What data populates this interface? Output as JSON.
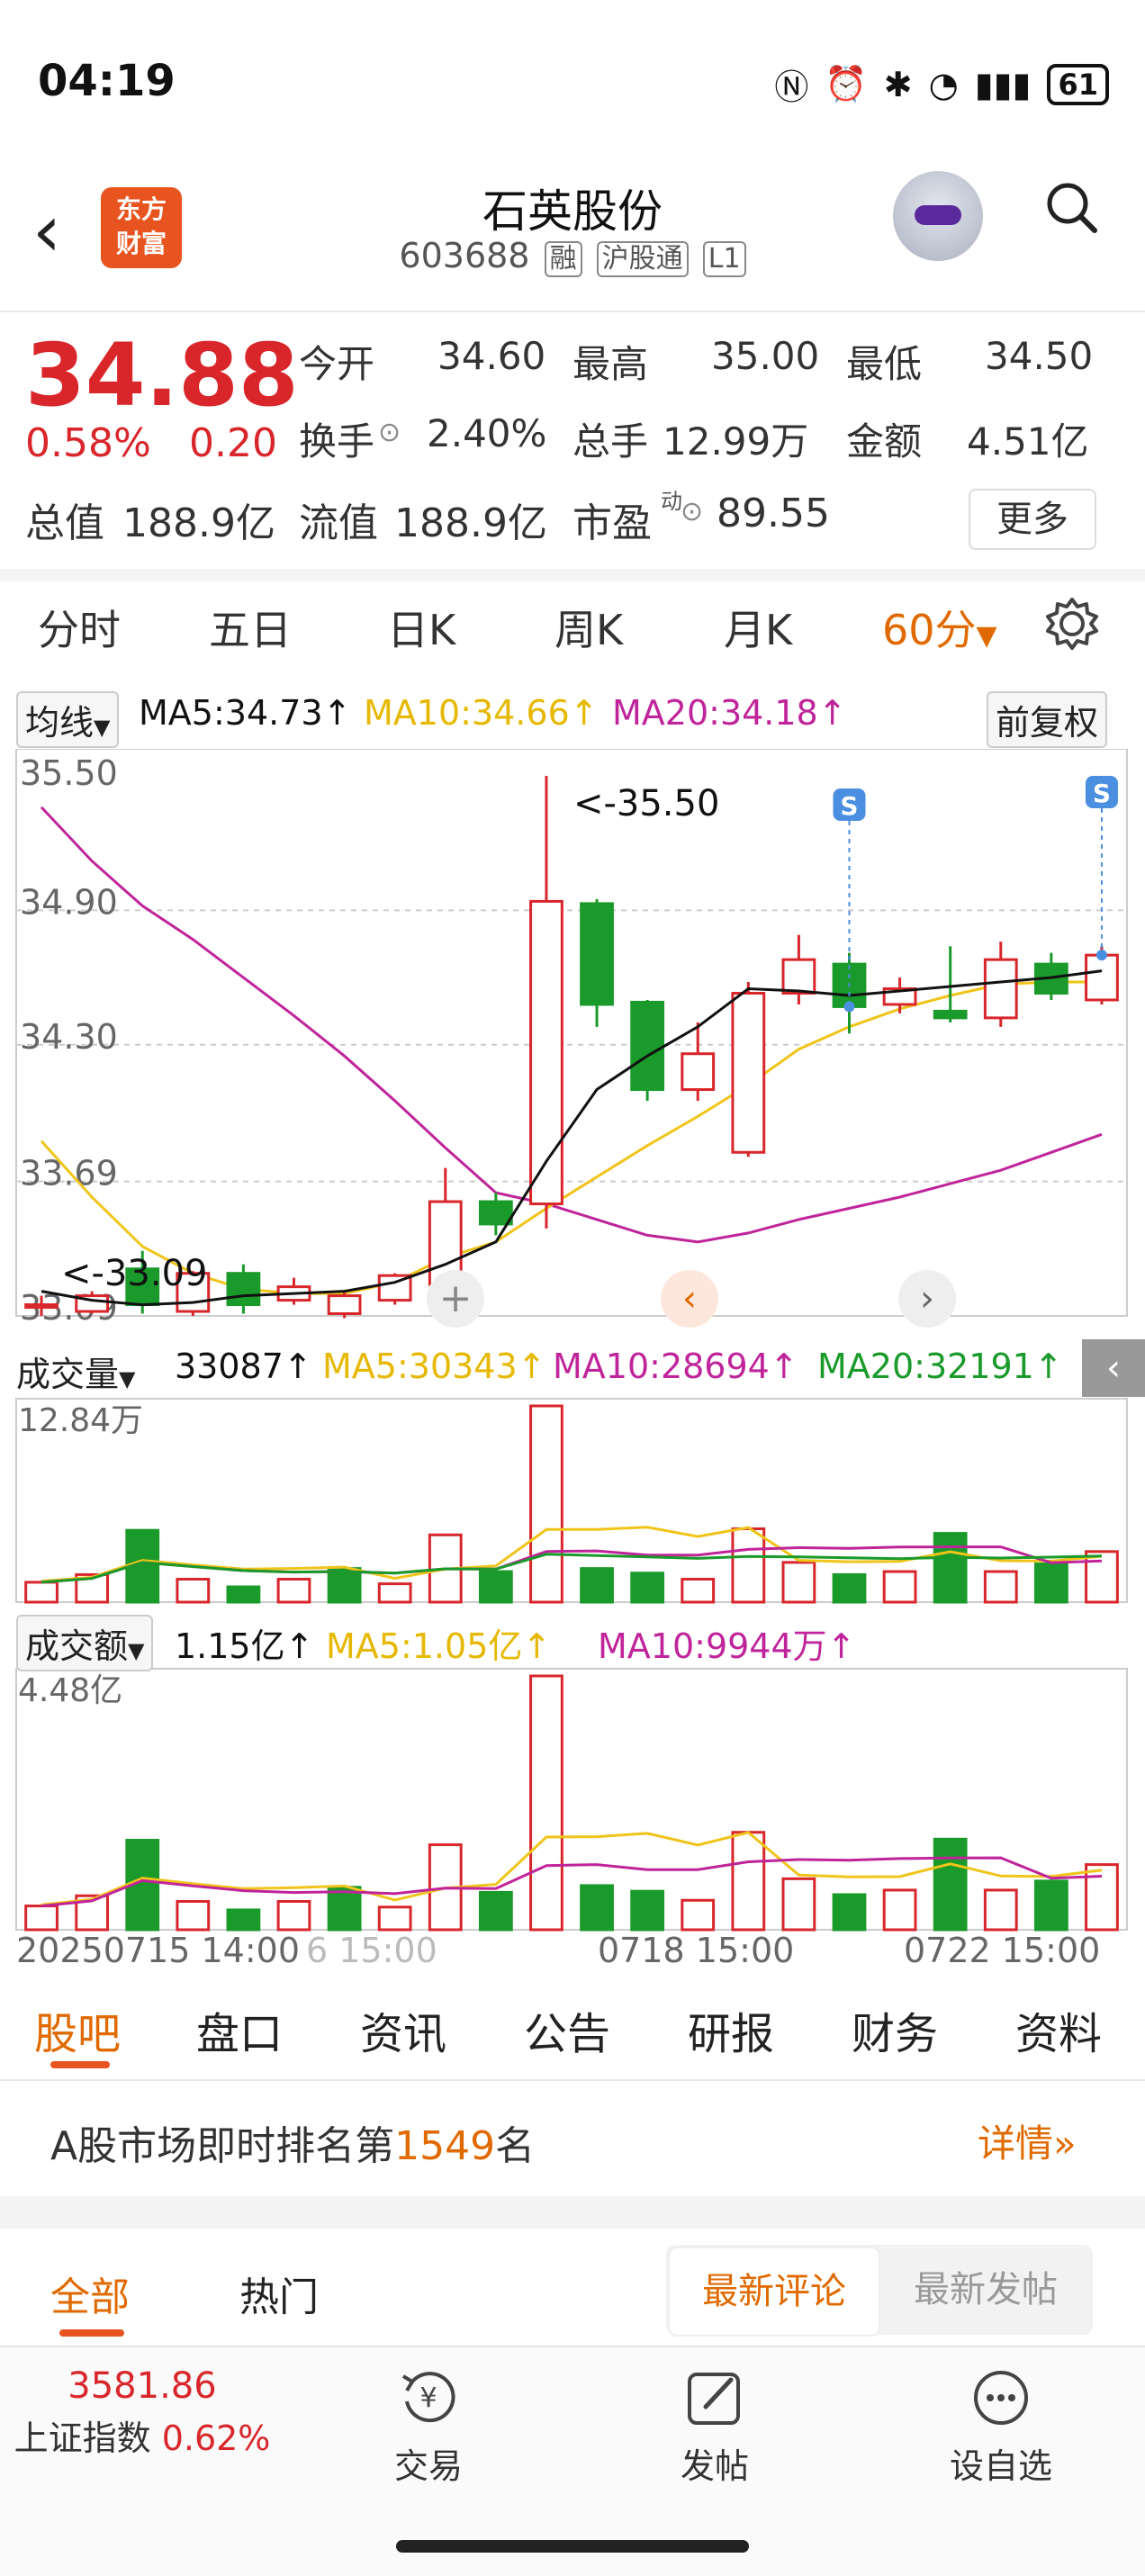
{
  "status": {
    "time": "04:19",
    "battery": "61"
  },
  "header": {
    "logo_line1": "东方",
    "logo_line2": "财富",
    "title": "石英股份",
    "code": "603688",
    "tags": [
      "融",
      "沪股通",
      "L1"
    ]
  },
  "quote": {
    "price": "34.88",
    "pct": "0.58%",
    "chg": "0.20",
    "open_label": "今开",
    "open": "34.60",
    "high_label": "最高",
    "high": "35.00",
    "low_label": "最低",
    "low": "34.50",
    "turnover_label": "换手",
    "turnover": "2.40%",
    "vol_label": "总手",
    "vol": "12.99万",
    "amount_label": "金额",
    "amount": "4.51亿",
    "cap_label": "总值",
    "cap": "188.9亿",
    "float_label": "流值",
    "float": "188.9亿",
    "pe_label": "市盈",
    "pe_sup": "动",
    "pe": "89.55",
    "more": "更多"
  },
  "period_tabs": [
    "分时",
    "五日",
    "日K",
    "周K",
    "月K",
    "60分"
  ],
  "ma": {
    "label": "均线",
    "ma5": "MA5:34.73↑",
    "ma10": "MA10:34.66↑",
    "ma20": "MA20:34.18↑",
    "adjust": "前复权"
  },
  "colors": {
    "up": "#d9262b",
    "down": "#1a9a2a",
    "ma5": "#111111",
    "ma10": "#f0c419",
    "ma20": "#c0249a",
    "accent": "#e06a00"
  },
  "chart_data": [
    {
      "type": "candlestick",
      "y_ticks": [
        "35.50",
        "34.90",
        "34.30",
        "33.69",
        "33.09"
      ],
      "ylim": [
        33.09,
        35.5
      ],
      "annotations": [
        "<-35.50",
        "<-33.09"
      ],
      "signals": [
        "S",
        "S"
      ],
      "candles": [
        {
          "o": 33.14,
          "c": 33.14,
          "h": 33.18,
          "l": 33.09,
          "up": true
        },
        {
          "o": 33.18,
          "c": 33.11,
          "h": 33.2,
          "l": 33.1,
          "up": true
        },
        {
          "o": 33.3,
          "c": 33.14,
          "h": 33.38,
          "l": 33.1,
          "up": false
        },
        {
          "o": 33.11,
          "c": 33.28,
          "h": 33.29,
          "l": 33.09,
          "up": true
        },
        {
          "o": 33.28,
          "c": 33.14,
          "h": 33.32,
          "l": 33.1,
          "up": false
        },
        {
          "o": 33.16,
          "c": 33.22,
          "h": 33.26,
          "l": 33.14,
          "up": true
        },
        {
          "o": 33.1,
          "c": 33.18,
          "h": 33.2,
          "l": 33.08,
          "up": true
        },
        {
          "o": 33.16,
          "c": 33.27,
          "h": 33.28,
          "l": 33.14,
          "up": true
        },
        {
          "o": 33.23,
          "c": 33.6,
          "h": 33.75,
          "l": 33.2,
          "up": true
        },
        {
          "o": 33.6,
          "c": 33.5,
          "h": 33.64,
          "l": 33.45,
          "up": false
        },
        {
          "o": 33.59,
          "c": 34.94,
          "h": 35.5,
          "l": 33.48,
          "up": true
        },
        {
          "o": 34.93,
          "c": 34.48,
          "h": 34.95,
          "l": 34.38,
          "up": false
        },
        {
          "o": 34.49,
          "c": 34.1,
          "h": 34.5,
          "l": 34.05,
          "up": false
        },
        {
          "o": 34.1,
          "c": 34.26,
          "h": 34.4,
          "l": 34.05,
          "up": true
        },
        {
          "o": 33.82,
          "c": 34.53,
          "h": 34.58,
          "l": 33.8,
          "up": true
        },
        {
          "o": 34.53,
          "c": 34.68,
          "h": 34.79,
          "l": 34.48,
          "up": true
        },
        {
          "o": 34.66,
          "c": 34.47,
          "h": 34.71,
          "l": 34.35,
          "up": false
        },
        {
          "o": 34.48,
          "c": 34.55,
          "h": 34.6,
          "l": 34.44,
          "up": true
        },
        {
          "o": 34.45,
          "c": 34.42,
          "h": 34.74,
          "l": 34.4,
          "up": false
        },
        {
          "o": 34.42,
          "c": 34.68,
          "h": 34.76,
          "l": 34.38,
          "up": true
        },
        {
          "o": 34.66,
          "c": 34.53,
          "h": 34.71,
          "l": 34.5,
          "up": false
        },
        {
          "o": 34.5,
          "c": 34.7,
          "h": 34.74,
          "l": 34.48,
          "up": true
        }
      ],
      "ma5": [
        33.2,
        33.16,
        33.14,
        33.15,
        33.18,
        33.19,
        33.2,
        33.24,
        33.32,
        33.42,
        33.78,
        34.1,
        34.25,
        34.38,
        34.55,
        34.54,
        34.52,
        34.54,
        34.56,
        34.58,
        34.6,
        34.63
      ],
      "ma10": [
        33.87,
        33.62,
        33.4,
        33.28,
        33.21,
        33.19,
        33.19,
        33.24,
        33.35,
        33.42,
        33.57,
        33.71,
        33.85,
        33.98,
        34.12,
        34.28,
        34.38,
        34.46,
        34.52,
        34.57,
        34.58,
        34.58
      ],
      "ma20": [
        35.36,
        35.12,
        34.92,
        34.77,
        34.6,
        34.43,
        34.25,
        34.05,
        33.84,
        33.64,
        33.59,
        33.52,
        33.45,
        33.42,
        33.46,
        33.52,
        33.57,
        33.62,
        33.68,
        33.74,
        33.82,
        33.9
      ]
    },
    {
      "type": "bar",
      "label": "成交量",
      "value": "33087↑",
      "ma5": "MA5:30343↑",
      "ma10": "MA10:28694↑",
      "ma20": "MA20:32191↑",
      "ymax_label": "12.84万",
      "ymax": 128400,
      "values": [
        13000,
        18000,
        47000,
        15000,
        10000,
        15000,
        22000,
        12000,
        44000,
        20000,
        128400,
        22000,
        19000,
        15000,
        48000,
        26000,
        18000,
        20000,
        45000,
        20000,
        25000,
        33087
      ],
      "up": [
        true,
        true,
        false,
        true,
        false,
        true,
        false,
        true,
        true,
        false,
        true,
        false,
        false,
        true,
        true,
        true,
        false,
        true,
        false,
        true,
        false,
        true
      ]
    },
    {
      "type": "bar",
      "label": "成交额",
      "value": "1.15亿↑",
      "ma5": "MA5:1.05亿↑",
      "ma10": "MA10:9944万↑",
      "ymax_label": "4.48亿",
      "ymax": 4.48,
      "values": [
        0.42,
        0.6,
        1.58,
        0.5,
        0.35,
        0.5,
        0.75,
        0.4,
        1.5,
        0.66,
        4.48,
        0.78,
        0.68,
        0.52,
        1.72,
        0.9,
        0.62,
        0.7,
        1.6,
        0.7,
        0.86,
        1.15
      ],
      "up": [
        true,
        true,
        false,
        true,
        false,
        true,
        false,
        true,
        true,
        false,
        true,
        false,
        false,
        true,
        true,
        true,
        false,
        true,
        false,
        true,
        false,
        true
      ]
    }
  ],
  "x_labels": [
    "20250715 14:00",
    "6 15:00",
    "0718 15:00",
    "0722 15:00"
  ],
  "footer_tabs": [
    "股吧",
    "盘口",
    "资讯",
    "公告",
    "研报",
    "财务",
    "资料"
  ],
  "rank": {
    "prefix": "A股市场即时排名第",
    "num": "1549",
    "suffix": "名",
    "link": "详情"
  },
  "comment_tabs": {
    "all": "全部",
    "hot": "热门",
    "latest_comment": "最新评论",
    "latest_post": "最新发帖"
  },
  "bottom": {
    "index_value": "3581.86",
    "index_name": "上证指数",
    "index_pct": "0.62%",
    "trade": "交易",
    "post": "发帖",
    "watch": "设自选"
  }
}
